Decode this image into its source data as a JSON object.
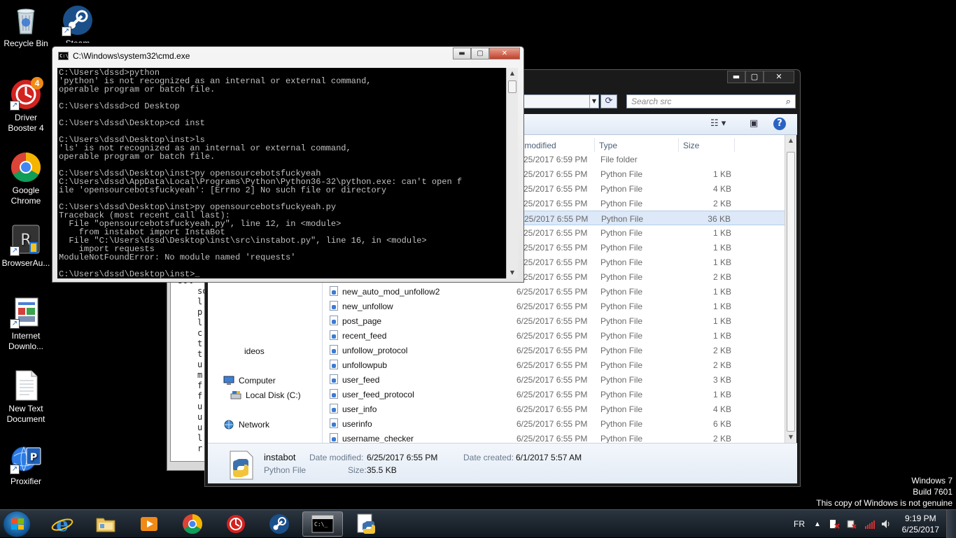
{
  "desktop_icons": [
    {
      "label": "Recycle Bin"
    },
    {
      "label": "Steam"
    },
    {
      "label": "Driver Booster 4",
      "badge": "4"
    },
    {
      "label": "Google Chrome"
    },
    {
      "label": "BrowserAu..."
    },
    {
      "label": "Internet Downlo..."
    },
    {
      "label": "New Text Document"
    },
    {
      "label": "Proxifier"
    }
  ],
  "cmd": {
    "title": "C:\\Windows\\system32\\cmd.exe",
    "minimize": "▬",
    "maximize": "▢",
    "close": "✕",
    "icon_text": "C:\\",
    "output": "C:\\Users\\dssd>python\n'python' is not recognized as an internal or external command,\noperable program or batch file.\n\nC:\\Users\\dssd>cd Desktop\n\nC:\\Users\\dssd\\Desktop>cd inst\n\nC:\\Users\\dssd\\Desktop\\inst>ls\n'ls' is not recognized as an internal or external command,\noperable program or batch file.\n\nC:\\Users\\dssd\\Desktop\\inst>py opensourcebotsfuckyeah\nC:\\Users\\dssd\\AppData\\Local\\Programs\\Python\\Python36-32\\python.exe: can't open f\nile 'opensourcebotsfuckyeah': [Errno 2] No such file or directory\n\nC:\\Users\\dssd\\Desktop\\inst>py opensourcebotsfuckyeah.py\nTraceback (most recent call last):\n  File \"opensourcebotsfuckyeah.py\", line 12, in <module>\n    from instabot import InstaBot\n  File \"C:\\Users\\dssd\\Desktop\\inst\\src\\instabot.py\", line 16, in <module>\n    import requests\nModuleNotFoundError: No module named 'requests'\n\nC:\\Users\\dssd\\Desktop\\inst>_"
  },
  "explorer": {
    "search_placeholder": "Search src",
    "columns": {
      "date": "te modified",
      "type": "Type",
      "size": "Size"
    },
    "nav": {
      "computer": "Computer",
      "local_disk": "Local Disk (C:)",
      "network": "Network"
    },
    "partial_nav_text": "ideos",
    "files": [
      {
        "name": "",
        "date": "6/25/2017 6:59 PM",
        "type": "File folder",
        "size": ""
      },
      {
        "name": "",
        "date": "6/25/2017 6:55 PM",
        "type": "Python File",
        "size": "1 KB"
      },
      {
        "name": "",
        "date": "6/25/2017 6:55 PM",
        "type": "Python File",
        "size": "4 KB"
      },
      {
        "name": "",
        "date": "6/25/2017 6:55 PM",
        "type": "Python File",
        "size": "2 KB"
      },
      {
        "name": "",
        "date": "6/25/2017 6:55 PM",
        "type": "Python File",
        "size": "36 KB",
        "selected": true
      },
      {
        "name": "",
        "date": "6/25/2017 6:55 PM",
        "type": "Python File",
        "size": "1 KB"
      },
      {
        "name": "",
        "date": "6/25/2017 6:55 PM",
        "type": "Python File",
        "size": "1 KB"
      },
      {
        "name": "",
        "date": "6/25/2017 6:55 PM",
        "type": "Python File",
        "size": "1 KB"
      },
      {
        "name": "",
        "date": "6/25/2017 6:55 PM",
        "type": "Python File",
        "size": "2 KB"
      },
      {
        "name": "new_auto_mod_unfollow2",
        "date": "6/25/2017 6:55 PM",
        "type": "Python File",
        "size": "1 KB"
      },
      {
        "name": "new_unfollow",
        "date": "6/25/2017 6:55 PM",
        "type": "Python File",
        "size": "1 KB"
      },
      {
        "name": "post_page",
        "date": "6/25/2017 6:55 PM",
        "type": "Python File",
        "size": "1 KB"
      },
      {
        "name": "recent_feed",
        "date": "6/25/2017 6:55 PM",
        "type": "Python File",
        "size": "1 KB"
      },
      {
        "name": "unfollow_protocol",
        "date": "6/25/2017 6:55 PM",
        "type": "Python File",
        "size": "2 KB"
      },
      {
        "name": "unfollowpub",
        "date": "6/25/2017 6:55 PM",
        "type": "Python File",
        "size": "2 KB"
      },
      {
        "name": "user_feed",
        "date": "6/25/2017 6:55 PM",
        "type": "Python File",
        "size": "3 KB"
      },
      {
        "name": "user_feed_protocol",
        "date": "6/25/2017 6:55 PM",
        "type": "Python File",
        "size": "1 KB"
      },
      {
        "name": "user_info",
        "date": "6/25/2017 6:55 PM",
        "type": "Python File",
        "size": "4 KB"
      },
      {
        "name": "userinfo",
        "date": "6/25/2017 6:55 PM",
        "type": "Python File",
        "size": "6 KB"
      },
      {
        "name": "username_checker",
        "date": "6/25/2017 6:55 PM",
        "type": "Python File",
        "size": "2 KB"
      }
    ],
    "details": {
      "name": "instabot",
      "type": "Python File",
      "modified_label": "Date modified:",
      "modified": "6/25/2017 6:55 PM",
      "created_label": "Date created:",
      "created": "6/1/2017 5:57 AM",
      "size_label": "Size:",
      "size": "35.5 KB"
    }
  },
  "notepad_partial": "sol\nl\np\nl\nc\nt\nt\nu\nm\nf\nf\nu\nu\nu\nl\nr",
  "notepad_heading": "sol",
  "watermark": {
    "line1": "Windows 7",
    "line2": "Build 7601",
    "line3": "This copy of Windows is not genuine"
  },
  "taskbar": {
    "language": "FR",
    "time": "9:19 PM",
    "date": "6/25/2017",
    "apps": [
      "internet-explorer",
      "file-explorer",
      "media-player",
      "chrome",
      "driver-booster",
      "steam",
      "cmd",
      "python"
    ],
    "active_app": "cmd"
  },
  "colors": {
    "console_bg": "#000000",
    "console_text": "#c0c0c0",
    "selection": "#dde9f8",
    "taskbar": "#1b232c"
  }
}
